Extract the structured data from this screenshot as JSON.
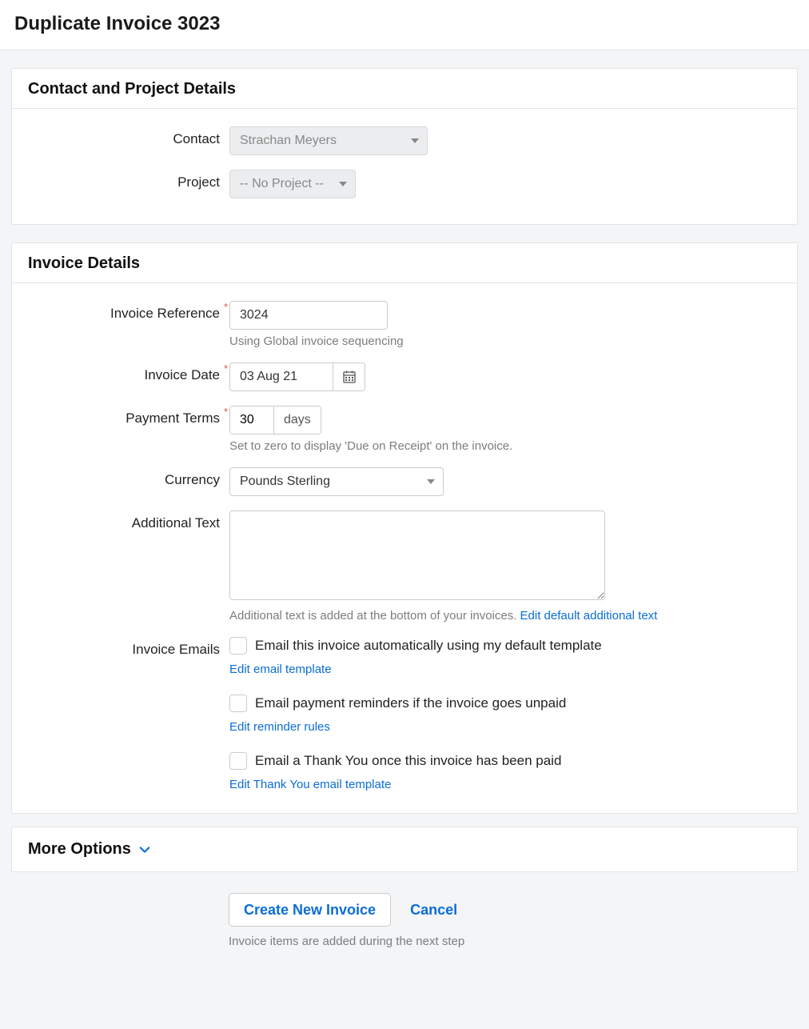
{
  "page_title": "Duplicate Invoice 3023",
  "section_contact": {
    "heading": "Contact and Project Details",
    "contact_label": "Contact",
    "contact_value": "Strachan Meyers",
    "project_label": "Project",
    "project_value": "-- No Project --"
  },
  "section_invoice": {
    "heading": "Invoice Details",
    "reference_label": "Invoice Reference",
    "reference_value": "3024",
    "reference_help": "Using Global invoice sequencing",
    "date_label": "Invoice Date",
    "date_value": "03 Aug 21",
    "terms_label": "Payment Terms",
    "terms_value": "30",
    "terms_unit": "days",
    "terms_help": "Set to zero to display 'Due on Receipt' on the invoice.",
    "currency_label": "Currency",
    "currency_value": "Pounds Sterling",
    "additional_label": "Additional Text",
    "additional_value": "",
    "additional_help": "Additional text is added at the bottom of your invoices. ",
    "additional_link": "Edit default additional text",
    "emails_label": "Invoice Emails",
    "email_auto": "Email this invoice automatically using my default template",
    "email_auto_link": "Edit email template",
    "email_reminder": "Email payment reminders if the invoice goes unpaid",
    "email_reminder_link": "Edit reminder rules",
    "email_thankyou": "Email a Thank You once this invoice has been paid",
    "email_thankyou_link": "Edit Thank You email template"
  },
  "more_options": "More Options",
  "actions": {
    "create": "Create New Invoice",
    "cancel": "Cancel",
    "help": "Invoice items are added during the next step"
  }
}
